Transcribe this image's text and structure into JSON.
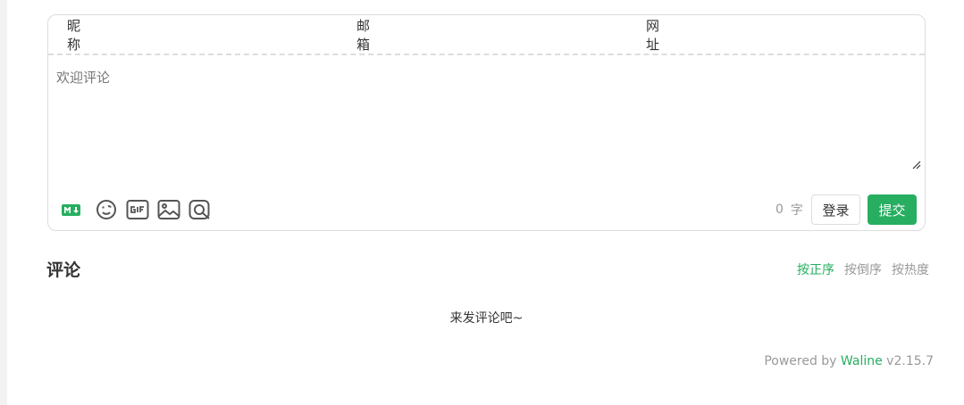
{
  "form": {
    "nick_label": "昵称",
    "mail_label": "邮箱",
    "link_label": "网址",
    "editor_placeholder": "欢迎评论"
  },
  "toolbar": {
    "icons": [
      "markdown-icon",
      "emoji-icon",
      "gif-icon",
      "image-icon",
      "preview-icon"
    ],
    "word_count": "0",
    "word_unit": "字",
    "login_label": "登录",
    "submit_label": "提交"
  },
  "comments": {
    "title": "评论",
    "sort_options": [
      "按正序",
      "按倒序",
      "按热度"
    ],
    "active_sort": "按正序",
    "empty_text": "来发评论吧~"
  },
  "footer": {
    "powered_prefix": "Powered by",
    "brand": "Waline",
    "version": "v2.15.7"
  },
  "colors": {
    "accent": "#27ae60",
    "border": "#dddddd",
    "muted_text": "#999999"
  }
}
